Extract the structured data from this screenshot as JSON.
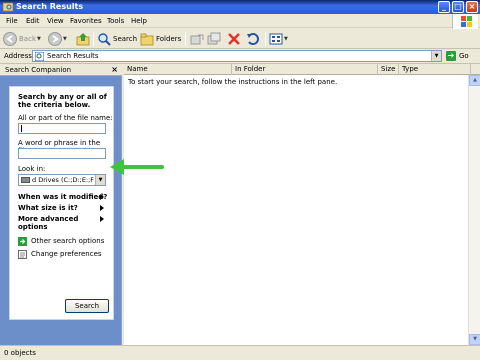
{
  "window": {
    "title": "Search Results"
  },
  "menu": [
    "File",
    "Edit",
    "View",
    "Favorites",
    "Tools",
    "Help"
  ],
  "toolbar": {
    "back_label": "Back",
    "search_label": "Search",
    "folders_label": "Folders"
  },
  "address": {
    "label": "Address",
    "value": "Search Results",
    "go_label": "Go"
  },
  "companion": {
    "header": "Search Companion",
    "close_glyph": "×",
    "heading_line1": "Search by any or all of",
    "heading_line2": "the criteria below.",
    "filename_label": "All or part of the file name:",
    "filename_value": "",
    "phrase_label": "A word or phrase in the file:",
    "phrase_value": "",
    "lookin_label": "Look in:",
    "lookin_value": "d Drives (C:;D:;E:;F:)",
    "when_modified": "When was it modified?",
    "size": "What size is it?",
    "advanced_line1": "More advanced",
    "advanced_line2": "options",
    "other_options": "Other search options",
    "change_prefs": "Change preferences",
    "search_button": "Search"
  },
  "results": {
    "columns": [
      "Name",
      "In Folder",
      "Size",
      "Type"
    ],
    "empty_message": "To start your search, follow the instructions in the left pane."
  },
  "status": {
    "text": "0 objects"
  },
  "colors": {
    "title_blue": "#245edb",
    "companion_blue": "#6c8fc9",
    "annotation_green": "#3cc43c"
  },
  "icons": [
    "window-icon",
    "back-icon",
    "forward-icon",
    "up-folder-icon",
    "search-icon",
    "folders-icon",
    "move-to-icon",
    "copy-to-icon",
    "delete-icon",
    "undo-icon",
    "views-icon",
    "go-icon",
    "drive-icon",
    "windows-logo-icon"
  ]
}
